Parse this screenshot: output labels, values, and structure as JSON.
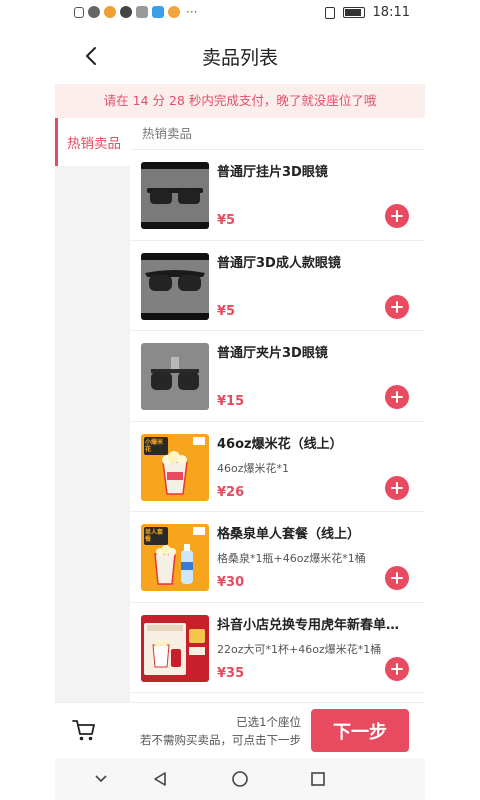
{
  "status_bar": {
    "time": "18:11"
  },
  "header": {
    "title": "卖品列表"
  },
  "notice": {
    "text": "请在 14 分 28 秒内完成支付，晚了就没座位了哦"
  },
  "sidebar": {
    "items": [
      {
        "label": "热销卖品"
      }
    ]
  },
  "section": {
    "title": "热销卖品"
  },
  "products": [
    {
      "name": "普通厅挂片3D眼镜",
      "desc": "",
      "price": "¥5",
      "thumb": "clip-glasses-icon"
    },
    {
      "name": "普通厅3D成人款眼镜",
      "desc": "",
      "price": "¥5",
      "thumb": "adult-glasses-icon"
    },
    {
      "name": "普通厅夹片3D眼镜",
      "desc": "",
      "price": "¥15",
      "thumb": "flip-glasses-icon"
    },
    {
      "name": "46oz爆米花（线上）",
      "desc": "46oz爆米花*1",
      "price": "¥26",
      "thumb": "popcorn-poster-icon",
      "badge": "小爆米花"
    },
    {
      "name": "格桑泉单人套餐（线上）",
      "desc": "格桑泉*1瓶+46oz爆米花*1桶",
      "price": "¥30",
      "thumb": "combo-poster-icon",
      "badge": "单人套餐"
    },
    {
      "name": "抖音小店兑换专用虎年新春单人...",
      "desc": "22oz大可*1杯+46oz爆米花*1桶",
      "price": "¥35",
      "thumb": "newyear-poster-icon"
    }
  ],
  "bottom": {
    "selected_text": "已选1个座位",
    "hint_text": "若不需购买卖品，可点击下一步",
    "next_label": "下一步"
  },
  "colors": {
    "accent": "#e84a5f",
    "notice_bg": "#fdeeee",
    "sidebar_bg": "#f3f3f3"
  }
}
